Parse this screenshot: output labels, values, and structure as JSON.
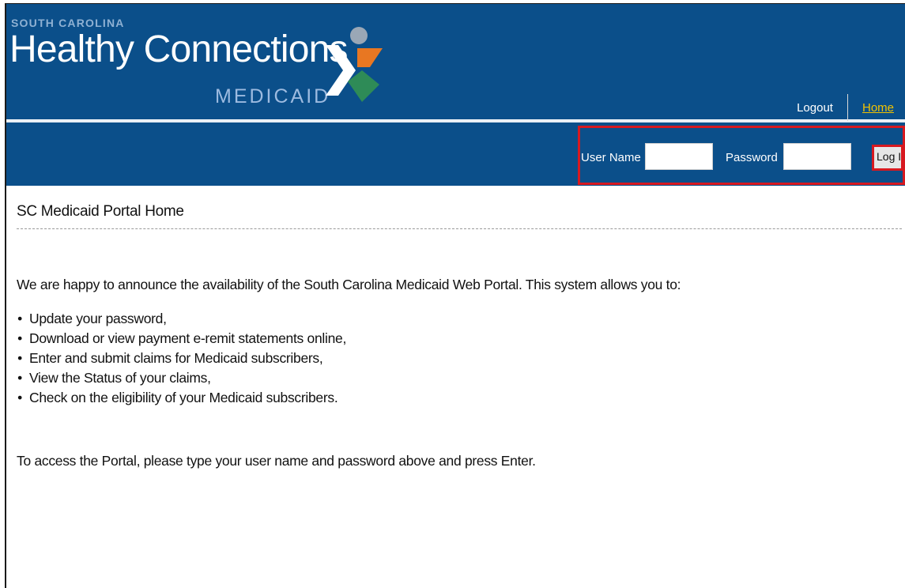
{
  "header": {
    "state_label": "SOUTH CAROLINA",
    "brand_name": "Healthy Connections",
    "brand_sub": "MEDICAID",
    "links": {
      "logout": "Logout",
      "home": "Home"
    }
  },
  "login": {
    "username_label": "User Name",
    "username_value": "",
    "password_label": "Password",
    "password_value": "",
    "button_label": "Log In"
  },
  "main": {
    "title": "SC Medicaid Portal Home",
    "intro": "We are happy to announce the availability of the South Carolina Medicaid Web Portal. This system allows you to:",
    "features": [
      "Update your password,",
      "Download or view payment e-remit statements online,",
      "Enter and submit claims for Medicaid subscribers,",
      "View the Status of your claims,",
      "Check on the eligibility of your Medicaid subscribers."
    ],
    "outro": "To access the Portal, please type your user name and password above and press Enter."
  },
  "colors": {
    "header_blue": "#0b4f8a",
    "highlight_red": "#d71920",
    "link_yellow": "#f2c200",
    "logo_gray": "#9aa7b6",
    "logo_orange": "#e87722",
    "logo_green": "#2e8b57",
    "logo_white": "#ffffff"
  }
}
